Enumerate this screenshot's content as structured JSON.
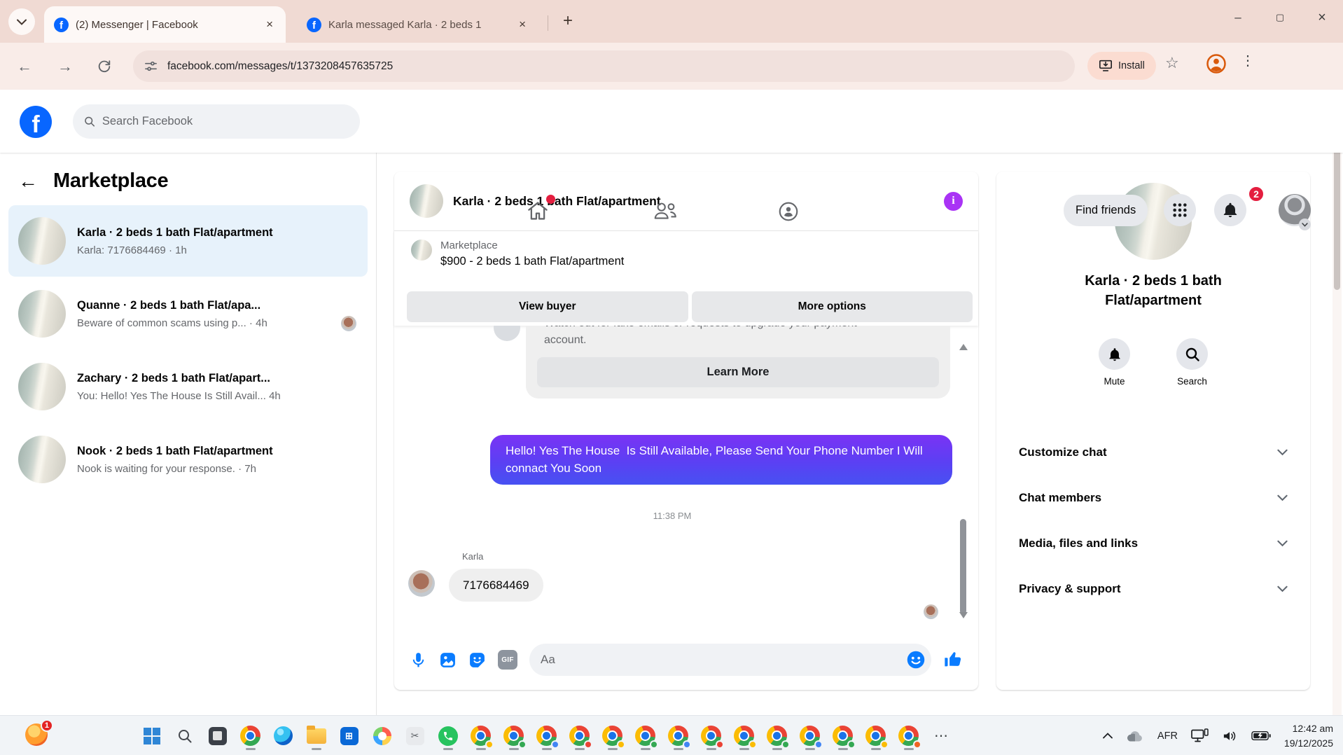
{
  "browser": {
    "tab1_title": "(2) Messenger | Facebook",
    "tab2_title": "Karla messaged Karla · 2 beds 1",
    "url": "facebook.com/messages/t/1373208457635725",
    "install_label": "Install",
    "new_tab_glyph": "+",
    "close_glyph": "×",
    "minimize_glyph": "–",
    "maximize_glyph": "▢",
    "back_glyph": "←",
    "forward_glyph": "→",
    "star_glyph": "☆",
    "kebab_glyph": "⋮",
    "chevron_glyph": "⌄"
  },
  "header": {
    "search_placeholder": "Search Facebook",
    "find_friends_label": "Find friends",
    "notification_count": "2"
  },
  "sidebar": {
    "title": "Marketplace",
    "back_glyph": "←",
    "chats": [
      {
        "name": "Karla · 2 beds 1 bath Flat/apartment",
        "preview": "Karla: 7176684469 ·",
        "time": "1h"
      },
      {
        "name": "Quanne · 2 beds 1 bath Flat/apa...",
        "preview": "Beware of common scams using p... ·",
        "time": "4h"
      },
      {
        "name": "Zachary · 2 beds 1 bath Flat/apart...",
        "preview": "You: Hello! Yes The House Is Still Avail...",
        "time": "4h"
      },
      {
        "name": "Nook · 2 beds 1 bath Flat/apartment",
        "preview": "Nook is waiting for your response. ·",
        "time": "7h"
      }
    ]
  },
  "chat": {
    "title": "Karla · 2 beds 1 bath Flat/apartment",
    "info_glyph": "i",
    "marketplace_label": "Marketplace",
    "listing": "$900 - 2 beds 1 bath Flat/apartment",
    "view_buyer_label": "View buyer",
    "more_options_label": "More options",
    "system_message": "Watch out for fake emails or requests to upgrade your payment account.",
    "learn_more_label": "Learn More",
    "sent_message": "Hello! Yes The House  Is Still Available, Please Send Your Phone Number I Will connact You Soon",
    "timestamp": "11:38 PM",
    "sender_name": "Karla",
    "received_message": "7176684469",
    "input_placeholder": "Aa",
    "gif_label": "GIF"
  },
  "panel": {
    "title_line1": "Karla · 2 beds 1 bath",
    "title_line2": "Flat/apartment",
    "mute_label": "Mute",
    "search_label": "Search",
    "menu": [
      "Customize chat",
      "Chat members",
      "Media, files and links",
      "Privacy & support"
    ]
  },
  "taskbar": {
    "notification_badge": "1",
    "language": "AFR",
    "time": "12:42 am",
    "date": "19/12/2025",
    "more_glyph": "⋯",
    "store_glyph": "⊞"
  },
  "colors": {
    "fb_blue": "#0866ff",
    "messenger_blue": "#0a7cff",
    "sent_gradient_top": "#7a33f5",
    "sent_gradient_bottom": "#4751f2",
    "badge_red": "#e41e3f",
    "info_purple": "#a933f5",
    "selected_chat_bg": "#e7f2fb",
    "browser_frame_pink": "#f0dad3"
  }
}
